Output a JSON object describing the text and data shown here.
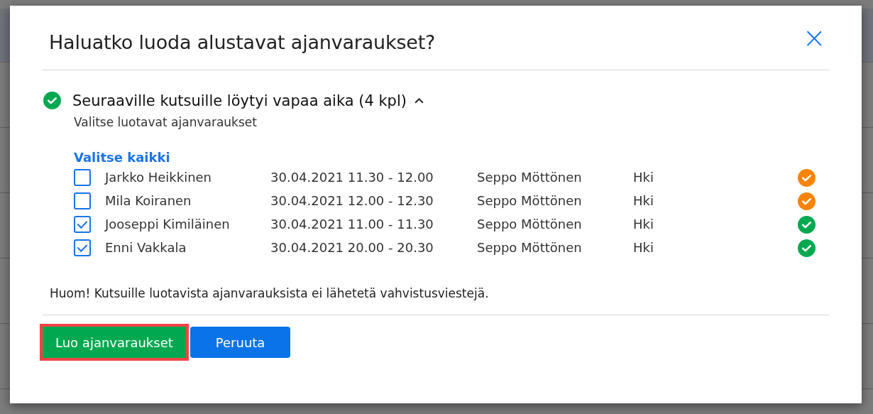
{
  "dialog": {
    "title": "Haluatko luoda alustavat ajanvaraukset?",
    "close": "×",
    "section": {
      "color": "#00a84f",
      "heading": "Seuraaville kutsuille löytyi vapaa aika (4 kpl)",
      "expanded": true,
      "subtitle": "Valitse luotavat ajanvaraukset",
      "select_all": "Valitse kaikki",
      "rows": [
        {
          "checked": false,
          "name": "Jarkko Heikkinen",
          "time": "30.04.2021 11.30 - 12.00",
          "person": "Seppo Möttönen",
          "place": "Hki",
          "color": "#f98304"
        },
        {
          "checked": false,
          "name": "Mila Koiranen",
          "time": "30.04.2021 12.00 - 12.30",
          "person": "Seppo Möttönen",
          "place": "Hki",
          "color": "#f98304"
        },
        {
          "checked": true,
          "name": "Jooseppi Kimiläinen",
          "time": "30.04.2021 11.00 - 11.30",
          "person": "Seppo Möttönen",
          "place": "Hki",
          "color": "#00a84f"
        },
        {
          "checked": true,
          "name": "Enni Vakkala",
          "time": "30.04.2021 20.00 - 20.30",
          "person": "Seppo Möttönen",
          "place": "Hki",
          "color": "#00a84f"
        }
      ]
    },
    "note": "Huom! Kutsuille luotavista ajanvarauksista ei lähetetä vahvistusviestejä.",
    "buttons": [
      {
        "kind": "primary",
        "label": "Luo ajanvaraukset",
        "highlighted": true
      },
      {
        "kind": "secondary",
        "label": "Peruuta",
        "highlighted": false
      }
    ]
  }
}
